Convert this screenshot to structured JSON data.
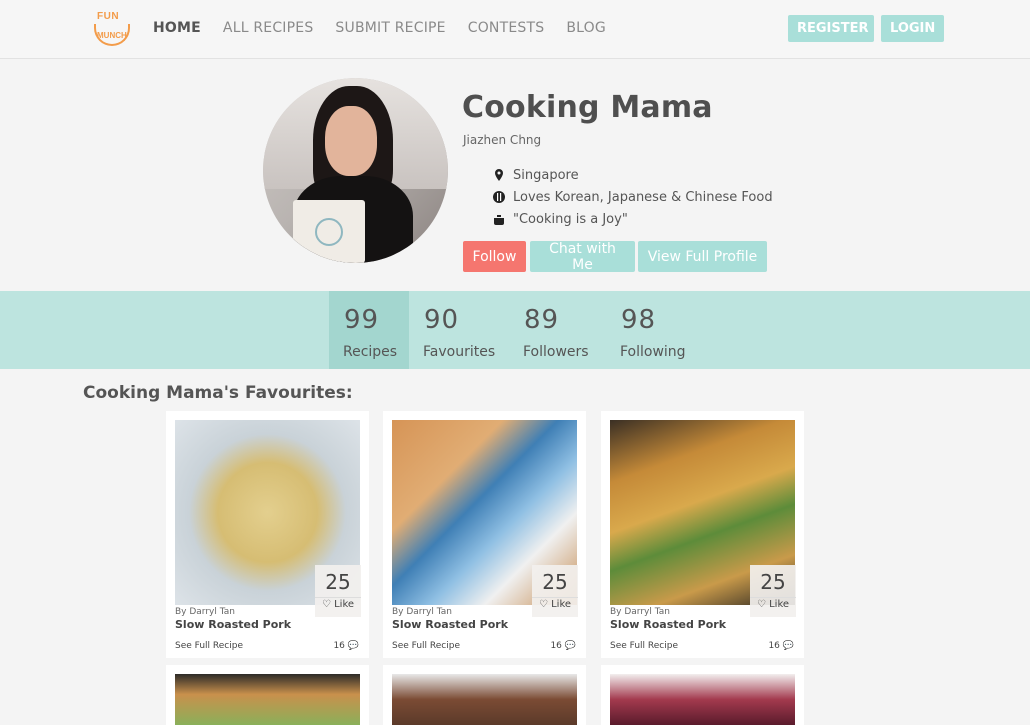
{
  "brand": {
    "logo_top": "FUN",
    "logo_bottom": "MUNCH",
    "accent": "#f39c4a"
  },
  "nav": {
    "items": [
      {
        "label": "HOME",
        "active": true
      },
      {
        "label": "ALL RECIPES",
        "active": false
      },
      {
        "label": "SUBMIT RECIPE",
        "active": false
      },
      {
        "label": "CONTESTS",
        "active": false
      },
      {
        "label": "BLOG",
        "active": false
      }
    ],
    "register_label": "REGISTER",
    "login_label": "LOGIN",
    "button_color": "#a9dfd9"
  },
  "profile": {
    "display_name": "Cooking Mama",
    "real_name": "Jiazhen Chng",
    "location": "Singapore",
    "loves": "Loves Korean, Japanese & Chinese Food",
    "motto": "\"Cooking is a Joy\"",
    "follow_label": "Follow",
    "chat_label": "Chat with Me",
    "view_profile_label": "View Full Profile",
    "follow_color": "#f5766f",
    "secondary_color": "#a9dfd9"
  },
  "stats": [
    {
      "value": "99",
      "label": "Recipes",
      "selected": true
    },
    {
      "value": "90",
      "label": "Favourites",
      "selected": false
    },
    {
      "value": "89",
      "label": "Followers",
      "selected": false
    },
    {
      "value": "98",
      "label": "Following",
      "selected": false
    }
  ],
  "section_title": "Cooking Mama's Favourites:",
  "cards": [
    {
      "likes": "25",
      "like_label": "Like",
      "author": "By Darryl Tan",
      "title": "Slow Roasted Pork",
      "see_label": "See Full Recipe",
      "comments": "16"
    },
    {
      "likes": "25",
      "like_label": "Like",
      "author": "By Darryl Tan",
      "title": "Slow Roasted Pork",
      "see_label": "See Full Recipe",
      "comments": "16"
    },
    {
      "likes": "25",
      "like_label": "Like",
      "author": "By Darryl Tan",
      "title": "Slow Roasted Pork",
      "see_label": "See Full Recipe",
      "comments": "16"
    }
  ]
}
